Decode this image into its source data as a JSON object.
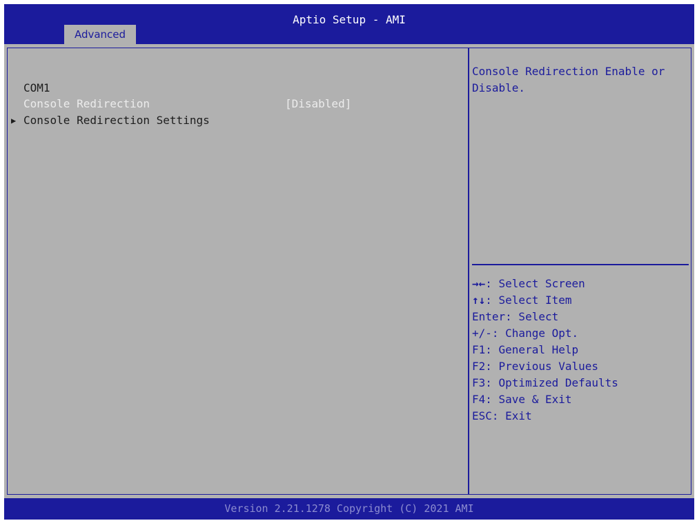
{
  "header": {
    "title": "Aptio Setup - AMI",
    "tabs": [
      {
        "label": "Advanced",
        "active": true
      }
    ]
  },
  "main": {
    "section_heading": "COM1",
    "items": [
      {
        "label": "Console Redirection",
        "value": "[Disabled]",
        "selected": true
      },
      {
        "label": "Console Redirection Settings",
        "submenu": true,
        "arrow_icon": "triangle-right-icon"
      }
    ]
  },
  "help": {
    "description": "Console Redirection Enable or Disable.",
    "keys": [
      {
        "key": "→←",
        "action": ": Select Screen"
      },
      {
        "key": "↑↓",
        "action": ": Select Item"
      },
      {
        "key": "",
        "action": "Enter: Select"
      },
      {
        "key": "",
        "action": "+/-: Change Opt."
      },
      {
        "key": "",
        "action": "F1: General Help"
      },
      {
        "key": "",
        "action": "F2: Previous Values"
      },
      {
        "key": "",
        "action": "F3: Optimized Defaults"
      },
      {
        "key": "",
        "action": "F4: Save & Exit"
      },
      {
        "key": "",
        "action": "ESC: Exit"
      }
    ]
  },
  "footer": {
    "version": "Version 2.21.1278 Copyright (C) 2021 AMI"
  },
  "colors": {
    "bar_blue": "#1b1b9c",
    "panel_gray": "#b1b1b1",
    "highlight_text": "#ececec",
    "footer_text": "#8c8cd0"
  }
}
